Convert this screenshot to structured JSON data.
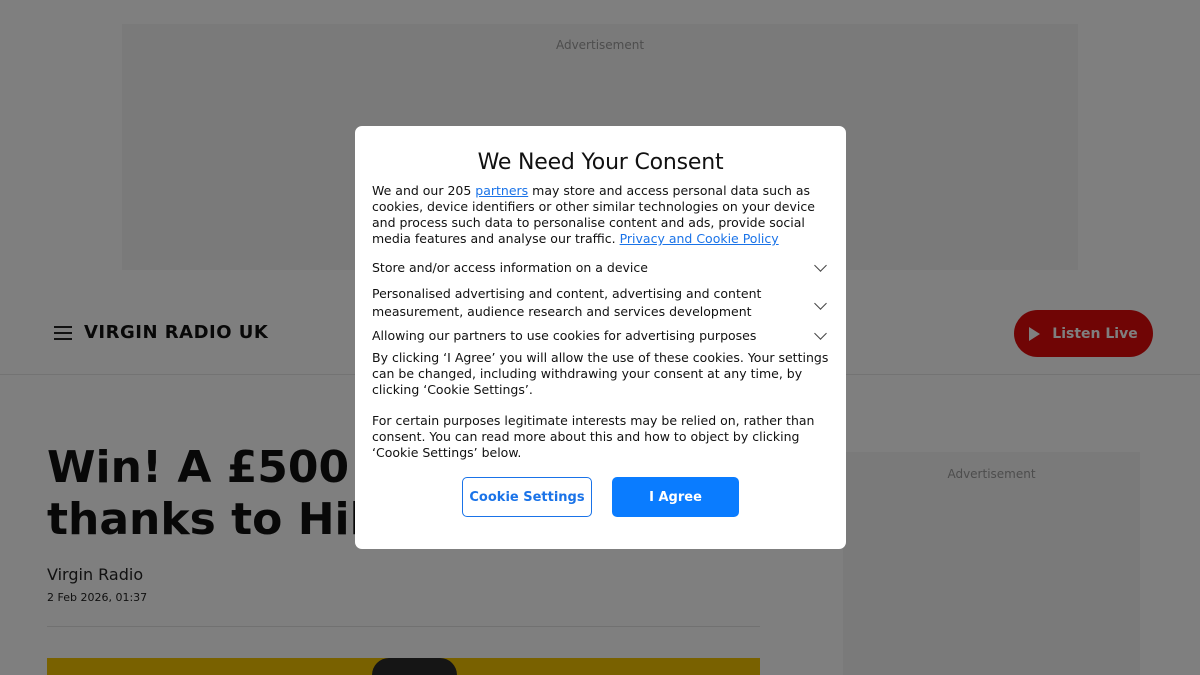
{
  "page": {
    "ad_label": "Advertisement",
    "logo": "VIRGIN RADIO UK",
    "listen_live": "Listen Live",
    "headline_line1": "Win! A £500",
    "headline_line2": "thanks to Hil",
    "author": "Virgin Radio",
    "date": "2 Feb 2026, 01:37",
    "brand_color": "#e10a0a"
  },
  "consent": {
    "title": "We Need Your Consent",
    "intro_prefix": "We and our 205 ",
    "partners_link": "partners",
    "intro_suffix": " may store and access personal data such as cookies, device identifiers or other similar technologies on your device and process such data to personalise content and ads, provide social media features and analyse our traffic. ",
    "policy_link": "Privacy and Cookie Policy",
    "purposes": [
      "Store and/or access information on a device",
      "Personalised advertising and content, advertising and content measurement, audience research and services development",
      "Allowing our partners to use cookies for advertising purposes"
    ],
    "agree_text": "By clicking ‘I Agree’ you will allow the use of these cookies. Your settings can be changed, including  withdrawing your consent at any time,  by clicking ‘Cookie Settings’.",
    "legit_text": "For certain purposes legitimate interests may be relied on, rather than consent. You can read more about this and how to object by clicking ‘Cookie Settings’ below.",
    "cookie_settings_button": "Cookie Settings",
    "agree_button": "I Agree",
    "accent_color": "#0a7cff"
  }
}
